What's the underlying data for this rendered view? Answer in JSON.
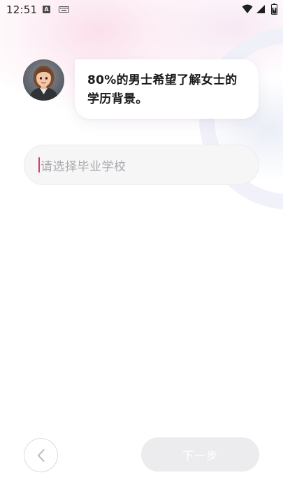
{
  "status_bar": {
    "time": "12:51",
    "icons": [
      "a-notification-icon",
      "keyboard-icon",
      "wifi-icon",
      "signal-icon",
      "battery-icon"
    ]
  },
  "question": {
    "avatar_icon": "avatar-woman-icon",
    "text": "80%的男士希望了解女士的学历背景。"
  },
  "school_input": {
    "value": "",
    "placeholder": "请选择毕业学校"
  },
  "navigation": {
    "back_icon": "chevron-left-icon",
    "next_label": "下一步",
    "next_enabled": false
  },
  "colors": {
    "caret": "#e0366e",
    "next_disabled_bg": "#ececee",
    "input_bg": "#f6f6f7"
  }
}
